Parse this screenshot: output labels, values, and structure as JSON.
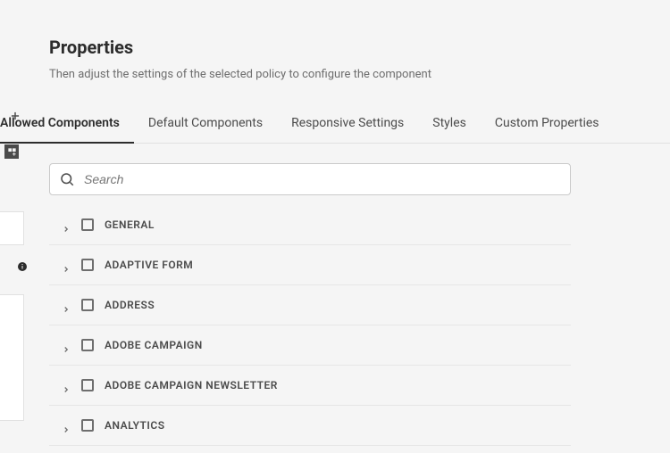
{
  "header": {
    "title": "Properties",
    "subtitle": "Then adjust the settings of the selected policy to configure the component"
  },
  "tabs": {
    "allowed": "Allowed Components",
    "default": "Default Components",
    "responsive": "Responsive Settings",
    "styles": "Styles",
    "custom": "Custom Properties"
  },
  "search": {
    "placeholder": "Search"
  },
  "groups": [
    {
      "label": "GENERAL"
    },
    {
      "label": "ADAPTIVE FORM"
    },
    {
      "label": "ADDRESS"
    },
    {
      "label": "ADOBE CAMPAIGN"
    },
    {
      "label": "ADOBE CAMPAIGN NEWSLETTER"
    },
    {
      "label": "ANALYTICS"
    }
  ]
}
